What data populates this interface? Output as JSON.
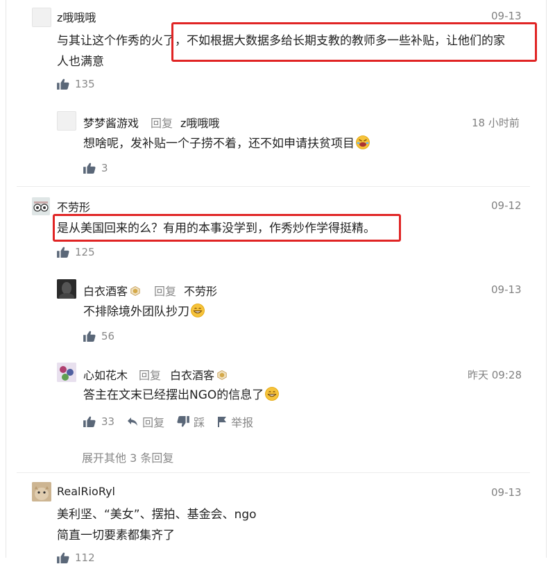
{
  "comments": [
    {
      "user": "z哦哦哦",
      "time": "09-13",
      "text_line1": "与其让这个作秀的火了，不如根据大数据多给长期支教的教师多一些补贴，让他们的家",
      "text_line2": "人也满意",
      "likes": "135",
      "replies": [
        {
          "user": "梦梦酱游戏",
          "reply_word": "回复",
          "reply_to": "z哦哦哦",
          "time": "18 小时前",
          "text": "想啥呢，发补贴一个子捞不着，还不如申请扶贫项目",
          "likes": "3"
        }
      ]
    },
    {
      "user": "不劳形",
      "time": "09-12",
      "text": "是从美国回来的么？有用的本事没学到，作秀炒作学得挺精。",
      "likes": "125",
      "replies": [
        {
          "user": "白衣酒客",
          "reply_word": "回复",
          "reply_to": "不劳形",
          "time": "09-13",
          "text": "不排除境外团队抄刀",
          "likes": "56"
        },
        {
          "user": "心如花木",
          "reply_word": "回复",
          "reply_to": "白衣酒客",
          "time": "昨天 09:28",
          "text": "答主在文末已经摆出NGO的信息了",
          "likes": "33",
          "actions": {
            "reply": "回复",
            "dislike": "踩",
            "report": "举报"
          }
        }
      ],
      "expand_more": "展开其他 3 条回复"
    },
    {
      "user": "RealRioRyl",
      "time": "09-13",
      "text_line1": "美利坚、“美女”、摆拍、基金会、ngo",
      "text_line2": "简直一切要素都集齐了",
      "likes": "112"
    }
  ],
  "colors": {
    "highlight_box": "#e02424",
    "muted": "#888888",
    "text": "#222222"
  }
}
